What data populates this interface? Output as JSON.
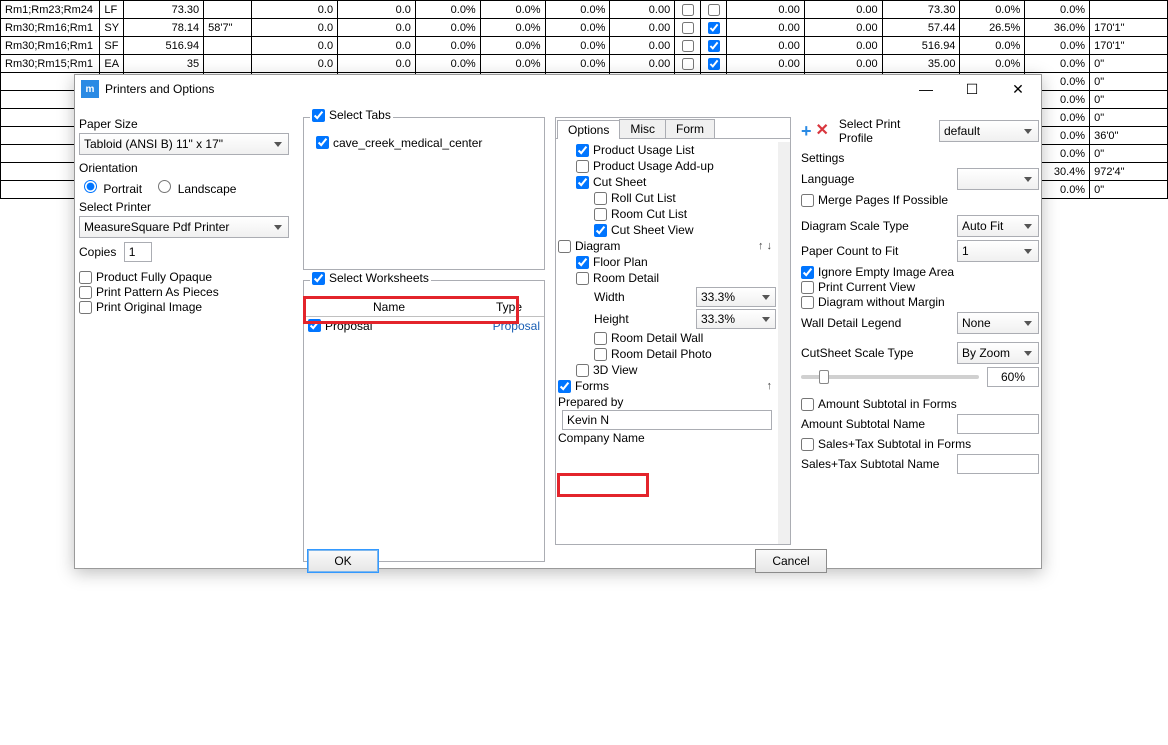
{
  "bg_rows": [
    {
      "c0": "Rm1;Rm23;Rm24",
      "c1": "LF",
      "c2": "73.30",
      "c3": "0.0",
      "c4": "0.0",
      "c5": "0.0%",
      "c6": "0.0%",
      "c7": "0.0%",
      "c8": "0.00",
      "cb1": false,
      "cb2": false,
      "c9": "0.00",
      "c10": "0.00",
      "c11": "73.30",
      "c12": "0.0%",
      "c13": "0.0%",
      "c14": ""
    },
    {
      "c0": "Rm30;Rm16;Rm1",
      "c1": "SY",
      "c2": "78.14",
      "c2b": "58'7\"",
      "c3": "0.0",
      "c4": "0.0",
      "c5": "0.0%",
      "c6": "0.0%",
      "c7": "0.0%",
      "c8": "0.00",
      "cb1": false,
      "cb2": true,
      "c9": "0.00",
      "c10": "0.00",
      "c11": "57.44",
      "c12": "26.5%",
      "c13": "36.0%",
      "c14": "170'1\""
    },
    {
      "c0": "Rm30;Rm16;Rm1",
      "c1": "SF",
      "c2": "516.94",
      "c3": "0.0",
      "c4": "0.0",
      "c5": "0.0%",
      "c6": "0.0%",
      "c7": "0.0%",
      "c8": "0.00",
      "cb1": false,
      "cb2": true,
      "c9": "0.00",
      "c10": "0.00",
      "c11": "516.94",
      "c12": "0.0%",
      "c13": "0.0%",
      "c14": "170'1\""
    },
    {
      "c0": "Rm30;Rm15;Rm1",
      "c1": "EA",
      "c2": "35",
      "c3": "0.0",
      "c4": "0.0",
      "c5": "0.0%",
      "c6": "0.0%",
      "c7": "0.0%",
      "c8": "0.00",
      "cb1": false,
      "cb2": true,
      "c9": "0.00",
      "c10": "0.00",
      "c11": "35.00",
      "c12": "0.0%",
      "c13": "0.0%",
      "c14": "0\""
    },
    {
      "c13": "0.0%",
      "c14": "0\""
    },
    {
      "c13": "0.0%",
      "c14": "0\""
    },
    {
      "c13": "0.0%",
      "c14": "0\""
    },
    {
      "c13": "0.0%",
      "c14": "36'0\""
    },
    {
      "c13": "0.0%",
      "c14": "0\""
    },
    {
      "c13": "30.4%",
      "c14": "972'4\""
    },
    {
      "c13": "0.0%",
      "c14": "0\""
    }
  ],
  "dialog": {
    "title": "Printers and Options",
    "paper_size_label": "Paper Size",
    "paper_size": "Tabloid (ANSI B) 11\" x 17\"",
    "orientation_label": "Orientation",
    "portrait": "Portrait",
    "landscape": "Landscape",
    "select_printer_label": "Select Printer",
    "printer": "MeasureSquare Pdf Printer",
    "copies_label": "Copies",
    "copies": "1",
    "opt_product_fully_opaque": "Product Fully Opaque",
    "opt_print_pattern": "Print Pattern As Pieces",
    "opt_print_original": "Print Original Image",
    "select_tabs": "Select Tabs",
    "tab_item": "cave_creek_medical_center",
    "select_worksheets": "Select Worksheets",
    "ws_name_hdr": "Name",
    "ws_type_hdr": "Type",
    "ws_name": "Proposal",
    "ws_type": "Proposal",
    "tabs": {
      "options": "Options",
      "misc": "Misc",
      "form": "Form"
    },
    "opts": {
      "product_usage_list": "Product Usage List",
      "product_usage_addup": "Product Usage Add-up",
      "cut_sheet": "Cut Sheet",
      "roll_cut_list": "Roll Cut List",
      "room_cut_list": "Room Cut List",
      "cut_sheet_view": "Cut Sheet View",
      "diagram": "Diagram",
      "floor_plan": "Floor Plan",
      "room_detail": "Room Detail",
      "width": "Width",
      "width_v": "33.3%",
      "height": "Height",
      "height_v": "33.3%",
      "room_detail_wall": "Room Detail Wall",
      "room_detail_photo": "Room Detail Photo",
      "three_d": "3D View",
      "forms": "Forms",
      "prepared_by": "Prepared by",
      "prepared_by_v": "Kevin N",
      "company_name": "Company Name"
    },
    "right": {
      "select_profile": "Select Print Profile",
      "profile": "default",
      "settings": "Settings",
      "language": "Language",
      "language_v": "",
      "merge_pages": "Merge Pages If Possible",
      "diagram_scale_type": "Diagram Scale Type",
      "diagram_scale_v": "Auto Fit",
      "paper_count": "Paper Count to Fit",
      "paper_count_v": "1",
      "ignore_empty": "Ignore Empty Image Area",
      "print_current": "Print Current View",
      "diagram_no_margin": "Diagram without Margin",
      "wall_legend": "Wall Detail Legend",
      "wall_legend_v": "None",
      "cutsheet_scale": "CutSheet Scale Type",
      "cutsheet_scale_v": "By Zoom",
      "slider_pct": "60%",
      "amount_subtotal": "Amount Subtotal in Forms",
      "amount_subtotal_name": "Amount Subtotal Name",
      "sales_tax_subtotal": "Sales+Tax Subtotal in Forms",
      "sales_tax_subtotal_name": "Sales+Tax Subtotal Name"
    },
    "ok": "OK",
    "cancel": "Cancel"
  }
}
